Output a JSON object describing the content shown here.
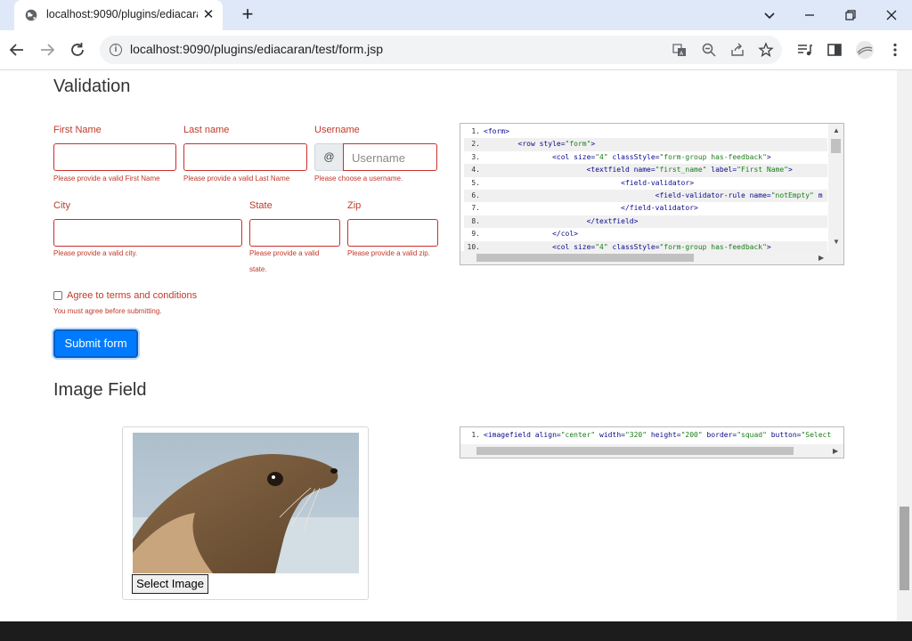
{
  "browser": {
    "tab_title": "localhost:9090/plugins/ediacaran",
    "url": "localhost:9090/plugins/ediacaran/test/form.jsp"
  },
  "validation": {
    "title": "Validation",
    "first_name": {
      "label": "First Name",
      "help": "Please provide a valid First Name"
    },
    "last_name": {
      "label": "Last name",
      "help": "Please provide a valid Last Name"
    },
    "username": {
      "label": "Username",
      "addon": "@",
      "placeholder": "Username",
      "help": "Please choose a username."
    },
    "city": {
      "label": "City",
      "help": "Please provide a valid city."
    },
    "state": {
      "label": "State",
      "help_line1": "Please provide a valid",
      "help_line2": "state."
    },
    "zip": {
      "label": "Zip",
      "help": "Please provide a valid zip."
    },
    "terms": {
      "label": "Agree to terms and conditions",
      "help": "You must agree before submitting."
    },
    "submit_label": "Submit form",
    "code_lines": [
      {
        "n": "1.",
        "text": "<form>"
      },
      {
        "n": "2.",
        "text": "        <row style=\"form\">"
      },
      {
        "n": "3.",
        "text": "                <col size=\"4\" classStyle=\"form-group has-feedback\">"
      },
      {
        "n": "4.",
        "text": "                        <textfield name=\"first_name\" label=\"First Name\">"
      },
      {
        "n": "5.",
        "text": "                                <field-validator>"
      },
      {
        "n": "6.",
        "text": "                                        <field-validator-rule name=\"notEmpty\" m"
      },
      {
        "n": "7.",
        "text": "                                </field-validator>"
      },
      {
        "n": "8.",
        "text": "                        </textfield>"
      },
      {
        "n": "9.",
        "text": "                </col>"
      },
      {
        "n": "10.",
        "text": "                <col size=\"4\" classStyle=\"form-group has-feedback\">"
      }
    ]
  },
  "image_field": {
    "title": "Image Field",
    "select_label": "Select Image",
    "code_lines": [
      {
        "n": "1.",
        "text": "<imagefield align=\"center\" width=\"320\" height=\"200\" border=\"squad\" button=\"Select"
      }
    ]
  }
}
